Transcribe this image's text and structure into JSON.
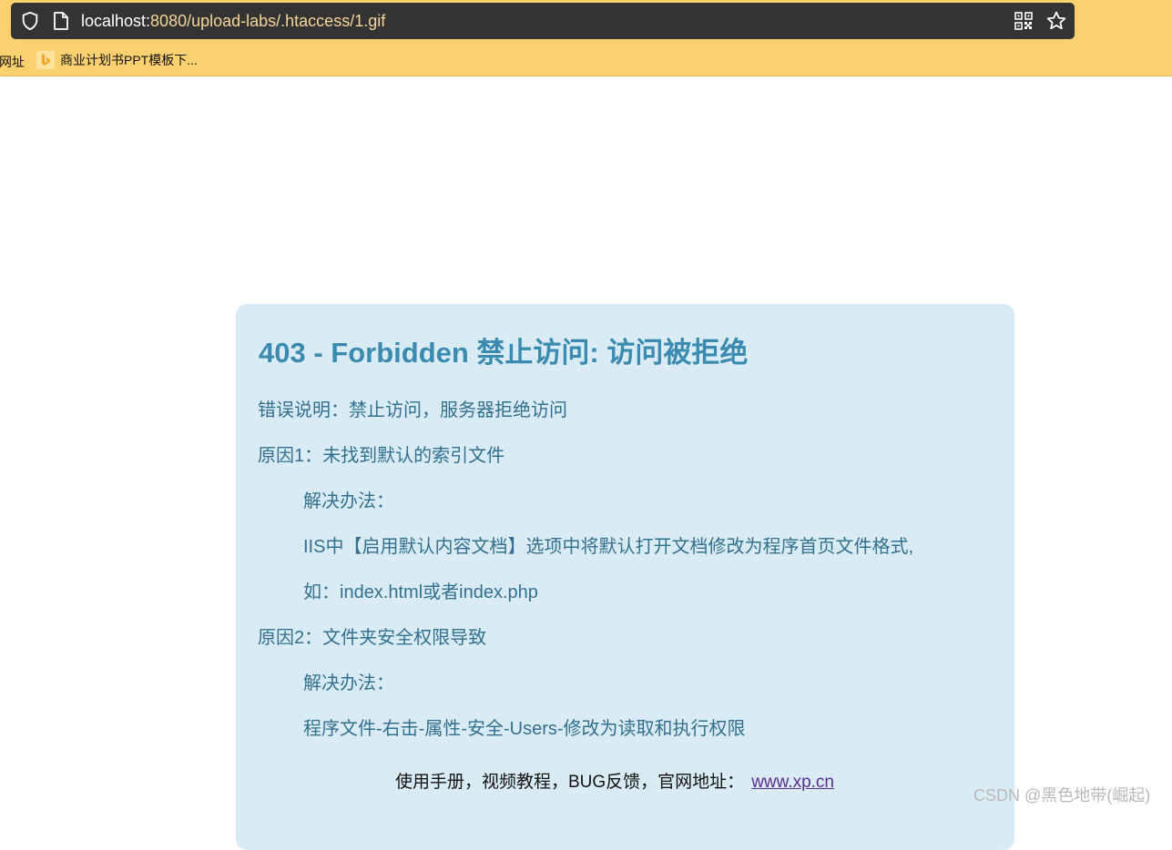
{
  "browser": {
    "url_host": "localhost:",
    "url_path": "8080/upload-labs/.htaccess/1.gif",
    "icons": [
      "shield-icon",
      "page-icon",
      "qr-code-icon",
      "star-icon"
    ],
    "bookmarks": [
      {
        "label": "网址"
      },
      {
        "label": "商业计划书PPT模板下...",
        "icon": "bing-icon"
      }
    ]
  },
  "error_page": {
    "title": "403 - Forbidden 禁止访问: 访问被拒绝",
    "lines": [
      "错误说明：禁止访问，服务器拒绝访问",
      "原因1：未找到默认的索引文件",
      "解决办法：",
      "IIS中【启用默认内容文档】选项中将默认打开文档修改为程序首页文件格式,",
      "如：index.html或者index.php",
      "原因2：文件夹安全权限导致",
      "解决办法：",
      "程序文件-右击-属性-安全-Users-修改为读取和执行权限"
    ],
    "footer_text": "使用手册，视频教程，BUG反馈，官网地址：",
    "footer_link": "www.xp.cn"
  },
  "watermark": "CSDN @黑色地带(崛起)",
  "colors": {
    "toolbar_bg": "#fbd06e",
    "urlbar_bg": "#333333",
    "panel_bg": "#d9ecf5",
    "title_color": "#3b8bb0",
    "text_color": "#33708e",
    "link_color": "#5a2d91"
  }
}
